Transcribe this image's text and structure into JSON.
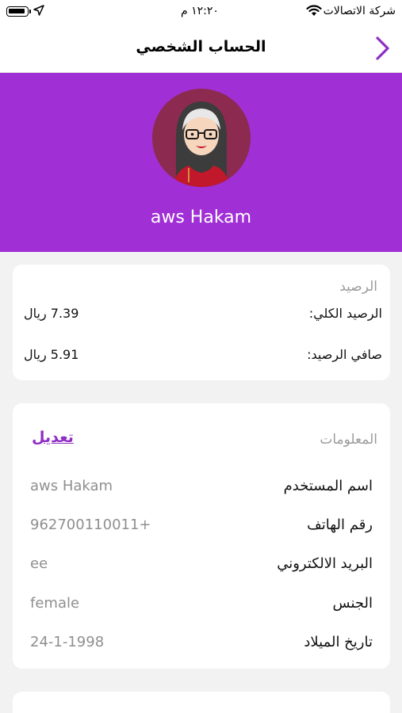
{
  "status_bar": {
    "carrier": "شركة الاتصالات",
    "time": "١٢:٢٠ م",
    "battery_icon": "battery-icon",
    "location_icon": "location-arrow-icon",
    "wifi_icon": "wifi-icon"
  },
  "nav": {
    "title": "الحساب الشخصي",
    "back_icon": "chevron-right-icon"
  },
  "profile": {
    "name": "aws Hakam",
    "avatar_icon": "hijab-avatar-icon",
    "accent_color": "#a12fd6"
  },
  "balance": {
    "section_title": "الرصيد",
    "total_label": "الرصيد الكلي:",
    "total_value": "7.39 ريال",
    "net_label": "صافي الرصيد:",
    "net_value": "5.91 ريال"
  },
  "info": {
    "section_title": "المعلومات",
    "edit_label": "تعديل",
    "fields": [
      {
        "label": "اسم المستخدم",
        "value": "aws Hakam"
      },
      {
        "label": "رقم الهاتف",
        "value": "962700110011+"
      },
      {
        "label": "البريد الالكتروني",
        "value": "ee"
      },
      {
        "label": "الجنس",
        "value": "female"
      },
      {
        "label": "تاريخ الميلاد",
        "value": "24-1-1998"
      }
    ]
  }
}
